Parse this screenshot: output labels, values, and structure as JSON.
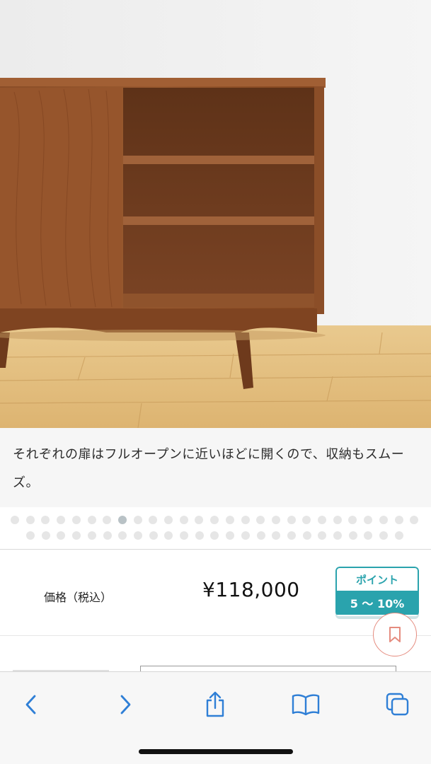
{
  "product": {
    "caption": "それぞれの扉はフルオープンに近いほどに開くので、収納もスムーズ。"
  },
  "gallery": {
    "active_index": 7
  },
  "price": {
    "label": "価格（税込）",
    "value": "¥118,000"
  },
  "points": {
    "title": "ポイント",
    "rate": "5 〜 10%"
  },
  "colors": {
    "accent": "#2aa3ad",
    "bookmark": "#e58c7f",
    "ios_blue": "#2f7fd6"
  },
  "icons": {
    "bookmark": "bookmark-icon",
    "back": "chevron-left-icon",
    "forward": "chevron-right-icon",
    "share": "share-icon",
    "bookmarks": "book-icon",
    "tabs": "tabs-icon"
  }
}
